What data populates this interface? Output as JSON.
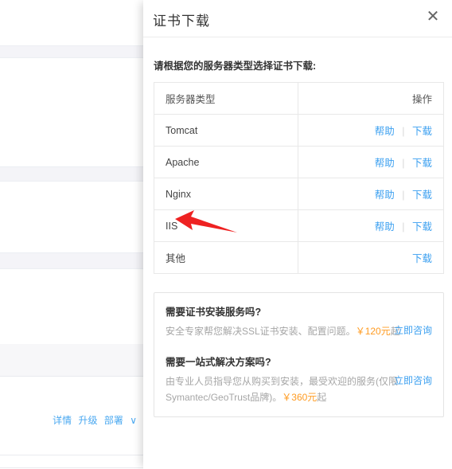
{
  "background": {
    "links": [
      "详情",
      "升级",
      "部署",
      "∨"
    ]
  },
  "drawer": {
    "title": "证书下载",
    "close_icon": "close-icon",
    "intro": "请根据您的服务器类型选择证书下载:",
    "table": {
      "headers": [
        "服务器类型",
        "操作"
      ],
      "rows": [
        {
          "type": "Tomcat",
          "actions": [
            "帮助",
            "下载"
          ]
        },
        {
          "type": "Apache",
          "actions": [
            "帮助",
            "下载"
          ]
        },
        {
          "type": "Nginx",
          "actions": [
            "帮助",
            "下载"
          ]
        },
        {
          "type": "IIS",
          "actions": [
            "帮助",
            "下载"
          ]
        },
        {
          "type": "其他",
          "actions": [
            "下载"
          ]
        }
      ]
    },
    "promos": [
      {
        "title": "需要证书安装服务吗?",
        "desc_before": "安全专家帮您解决SSL证书安装、配置问题。",
        "price": "￥120元",
        "desc_after": "起",
        "cta": "立即咨询"
      },
      {
        "title": "需要一站式解决方案吗?",
        "desc_before": "由专业人员指导您从购买到安装，最受欢迎的服务(仅限Symantec/GeoTrust品牌)。",
        "price": "￥360元",
        "desc_after": "起",
        "cta": "立即咨询"
      }
    ]
  },
  "annotation": {
    "arrow_color": "#ee2222",
    "points_at": "IIS"
  },
  "colors": {
    "link": "#3ca0f0",
    "price": "#ff9b21",
    "border": "#e8e8e8",
    "arrow": "#ee2222"
  }
}
